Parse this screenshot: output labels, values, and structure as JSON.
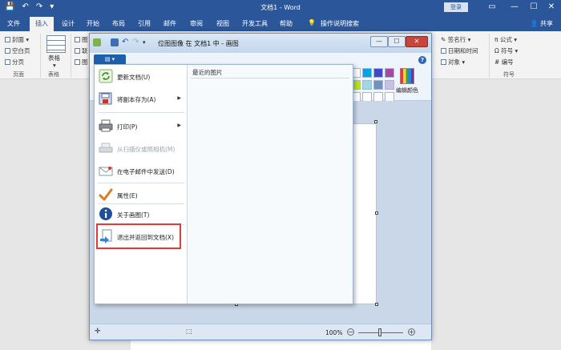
{
  "word": {
    "title": "文档1 - Word",
    "login": "登录",
    "quick_access": {
      "save_icon": "floppy-disk",
      "undo_icon": "undo-arrow",
      "redo_icon": "redo-arrow"
    },
    "window_buttons": [
      "▭",
      "—",
      "☐",
      "✕"
    ],
    "tabs": [
      "文件",
      "插入",
      "设计",
      "开始",
      "布局",
      "引用",
      "邮件",
      "审阅",
      "视图",
      "开发工具",
      "帮助",
      "操作说明搜索"
    ],
    "active_tab": "插入",
    "share": "共享",
    "ribbon": {
      "pages_items": [
        "封面",
        "空白页",
        "分页"
      ],
      "pages_group": "页面",
      "table_label": "表格",
      "table_group": "表格",
      "left_partial": [
        "图",
        "联",
        "图"
      ],
      "signature": "签名行",
      "datetime": "日期和时间",
      "object": "对象",
      "formula": "公式",
      "symbol": "符号",
      "number": "编号",
      "symbols_group": "符号"
    }
  },
  "paint": {
    "title": "位图图像 在 文档1 中 - 画图",
    "help": "?",
    "edit_colors": "编辑颜色",
    "zoom": "100%",
    "zoom_minus": "−",
    "zoom_plus": "+",
    "colors": [
      "#ffffff",
      "#00a2e8",
      "#3f48cc",
      "#a349a4",
      "#ffffff",
      "#b5e61d",
      "#99d9ea",
      "#7092be",
      "#c8bfe7",
      "#ffffff",
      "#ffffff",
      "#ffffff",
      "#ffffff",
      "#ffffff",
      "#ffffff"
    ]
  },
  "app_menu": {
    "recent_header": "最近的图片",
    "items": [
      {
        "label": "更新文档(U)",
        "icon": "update-icon"
      },
      {
        "label": "将副本存为(A)",
        "icon": "save-copy-icon",
        "submenu": "▶"
      },
      {
        "label": "打印(P)",
        "icon": "printer-icon",
        "submenu": "▶"
      },
      {
        "label": "从扫描仪或照相机(M)",
        "icon": "scanner-icon",
        "disabled": true
      },
      {
        "label": "在电子邮件中发送(D)",
        "icon": "email-icon"
      },
      {
        "label": "属性(E)",
        "icon": "checkmark-icon"
      },
      {
        "label": "关于画图(T)",
        "icon": "info-icon"
      },
      {
        "label": "退出并返回到文档(X)",
        "icon": "exit-return-icon"
      }
    ]
  }
}
